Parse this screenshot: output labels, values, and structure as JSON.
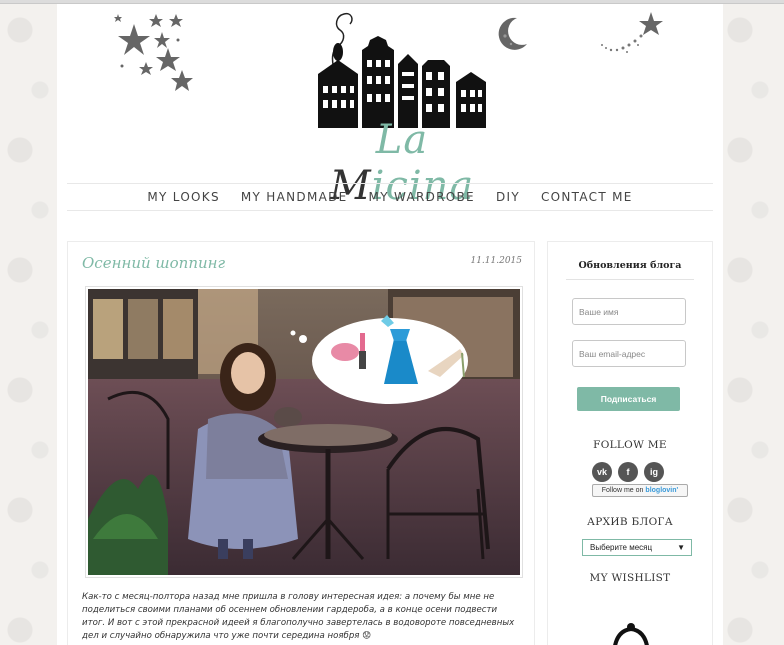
{
  "header": {
    "logo_part1": "La ",
    "logo_part2": "M",
    "logo_part3": "icina",
    "accent_color": "#7fb9a6"
  },
  "nav": {
    "items": [
      "MY LOOKS",
      "MY HANDMADE",
      "MY WARDROBE",
      "DIY",
      "CONTACT ME"
    ]
  },
  "post": {
    "title": "Осенний шоппинг",
    "date": "11.11.2015",
    "body": "Как-то с месяц-полтора назад мне пришла в голову интересная идея: а почему бы мне не поделиться своими планами об осеннем обновлении гардероба, а в конце осени подвести итог. И вот с этой прекрасной идеей я благополучно завертелась в водовороте повседневных дел и случайно обнаружила что уже почти середина ноября",
    "emoji": "😟"
  },
  "sidebar": {
    "subscribe_title": "Обновления блога",
    "name_placeholder": "Ваше имя",
    "email_placeholder": "Ваш email-адрес",
    "subscribe_button": "Подписаться",
    "follow_title": "FOLLOW ME",
    "social": [
      "vk",
      "f",
      "ig"
    ],
    "bloglovin_prefix": "Follow me on",
    "bloglovin_brand": "bloglovin'",
    "archive_title": "АРХИВ БЛОГА",
    "archive_select": "Выберите месяц",
    "wishlist_title": "MY WISHLIST"
  },
  "icons": [
    "stars-icon",
    "moon-icon",
    "houses-logo-icon",
    "vk-icon",
    "facebook-icon",
    "instagram-icon",
    "dropdown-arrow-icon"
  ]
}
